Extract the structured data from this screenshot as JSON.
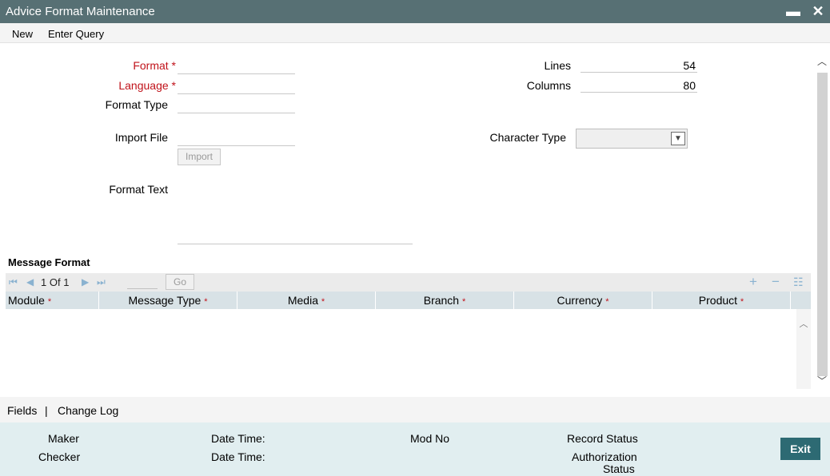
{
  "window": {
    "title": "Advice Format Maintenance",
    "minimize_glyph": "▬",
    "close_glyph": "✕"
  },
  "menu": {
    "new": "New",
    "enter_query": "Enter Query"
  },
  "form": {
    "format_label": "Format *",
    "format_value": "",
    "language_label": "Language *",
    "language_value": "",
    "format_type_label": "Format Type",
    "format_type_value": "",
    "lines_label": "Lines",
    "lines_value": "54",
    "columns_label": "Columns",
    "columns_value": "80",
    "import_file_label": "Import File",
    "import_file_value": "",
    "import_button": "Import",
    "character_type_label": "Character Type",
    "character_type_value": "",
    "format_text_label": "Format Text"
  },
  "message_format": {
    "title": "Message Format",
    "page_current": "1",
    "page_of": "Of",
    "page_total": "1",
    "go_button": "Go",
    "columns": [
      {
        "label": "Module",
        "required": "*"
      },
      {
        "label": "Message Type",
        "required": "*"
      },
      {
        "label": "Media",
        "required": "*"
      },
      {
        "label": "Branch",
        "required": "*"
      },
      {
        "label": "Currency",
        "required": "*"
      },
      {
        "label": "Product",
        "required": "*"
      }
    ]
  },
  "links": {
    "fields": "Fields",
    "separator": "|",
    "change_log": "Change Log"
  },
  "footer": {
    "maker": "Maker",
    "checker": "Checker",
    "date_time_1": "Date Time:",
    "date_time_2": "Date Time:",
    "mod_no": "Mod No",
    "record_status": "Record Status",
    "authorization_status_line1": "Authorization",
    "authorization_status_line2": "Status",
    "exit_button": "Exit"
  },
  "colors": {
    "titlebar": "#577074",
    "required": "#c0121a",
    "exit_button": "#2d6a73",
    "footer": "#e1eef0",
    "grid_header": "#d8e2e6"
  }
}
